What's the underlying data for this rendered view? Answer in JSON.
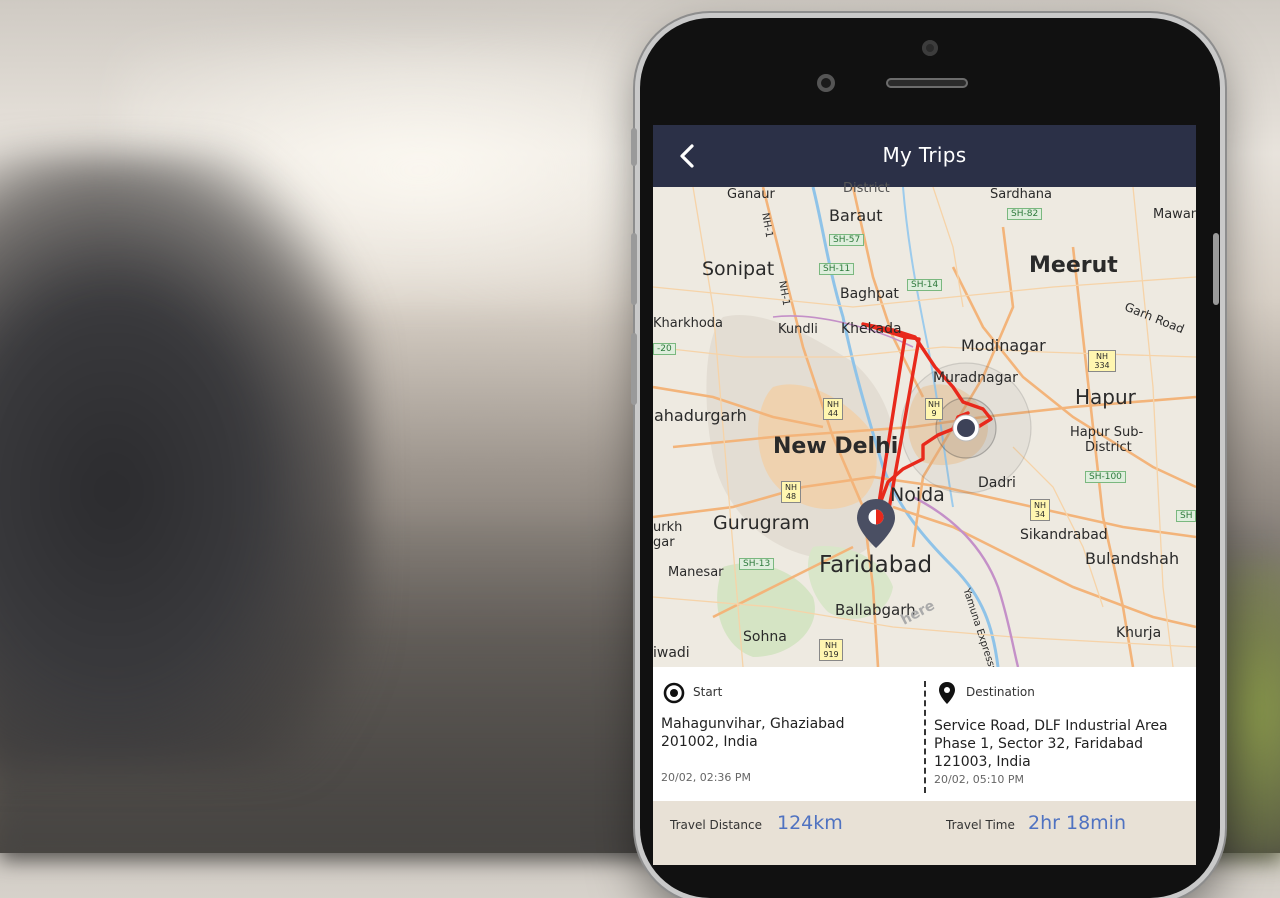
{
  "header": {
    "title": "My Trips",
    "back_icon": "chevron-left-icon"
  },
  "map": {
    "cities": [
      {
        "name": "Ganaur",
        "key": "ganaur"
      },
      {
        "name": "District",
        "key": "district"
      },
      {
        "name": "Sardhana",
        "key": "sardhana"
      },
      {
        "name": "Mawan",
        "key": "mawan"
      },
      {
        "name": "Baraut",
        "key": "baraut"
      },
      {
        "name": "Sonipat",
        "key": "sonipat"
      },
      {
        "name": "Meerut",
        "key": "meerut"
      },
      {
        "name": "Baghpat",
        "key": "baghpat"
      },
      {
        "name": "Garh Road",
        "key": "garh-road"
      },
      {
        "name": "Kharkhoda",
        "key": "kharkhoda"
      },
      {
        "name": "Kundli",
        "key": "kundli"
      },
      {
        "name": "Khekada",
        "key": "khekada"
      },
      {
        "name": "Modinagar",
        "key": "modinagar"
      },
      {
        "name": "Muradnagar",
        "key": "muradnagar"
      },
      {
        "name": "Bahadurgarh",
        "key": "bahadurgarh"
      },
      {
        "name": "Hapur",
        "key": "hapur"
      },
      {
        "name": "Hapur Sub-",
        "key": "hapur-sub"
      },
      {
        "name": "District",
        "key": "hapur-district"
      },
      {
        "name": "New Delhi",
        "key": "new-delhi"
      },
      {
        "name": "Dadri",
        "key": "dadri"
      },
      {
        "name": "Noida",
        "key": "noida"
      },
      {
        "name": "Gurugram",
        "key": "gurugram"
      },
      {
        "name": "urkh",
        "key": "jhajjar-frag"
      },
      {
        "name": "gar",
        "key": "gar-frag"
      },
      {
        "name": "Sikandrabad",
        "key": "sikandrabad"
      },
      {
        "name": "Bulandshah",
        "key": "bulandshah"
      },
      {
        "name": "Manesar",
        "key": "manesar"
      },
      {
        "name": "Faridabad",
        "key": "faridabad"
      },
      {
        "name": "Ballabgarh",
        "key": "ballabgarh"
      },
      {
        "name": "Sohna",
        "key": "sohna"
      },
      {
        "name": "Khurja",
        "key": "khurja"
      },
      {
        "name": "iwadi",
        "key": "rewari-frag"
      },
      {
        "name": "Yamuna Expressway",
        "key": "yamuna"
      },
      {
        "name": "NH-1",
        "key": "nh1-top"
      },
      {
        "name": "NH-1",
        "key": "nh1-mid"
      },
      {
        "name": "here",
        "key": "here"
      }
    ],
    "shields": [
      {
        "text": "SH-82",
        "key": "sh82"
      },
      {
        "text": "SH-57",
        "key": "sh57"
      },
      {
        "text": "SH-11",
        "key": "sh11"
      },
      {
        "text": "SH-14",
        "key": "sh14"
      },
      {
        "text": "NH 334",
        "key": "nh334"
      },
      {
        "text": "-20",
        "key": "sh20"
      },
      {
        "text": "NH 44",
        "key": "nh44"
      },
      {
        "text": "NH 9",
        "key": "nh9"
      },
      {
        "text": "SH-100",
        "key": "sh100"
      },
      {
        "text": "NH 48",
        "key": "nh48"
      },
      {
        "text": "NH 34",
        "key": "nh34"
      },
      {
        "text": "SH-13",
        "key": "sh13"
      },
      {
        "text": "NH 919",
        "key": "nh919"
      },
      {
        "text": "SH",
        "key": "sh-right"
      }
    ],
    "route_color": "#e8291c",
    "marker_start": "target-marker-icon",
    "marker_destination": "map-pin-icon"
  },
  "trip": {
    "start": {
      "label": "Start",
      "icon": "start-circle-icon",
      "address_line1": "Mahagunvihar, Ghaziabad",
      "address_line2": "201002, India",
      "time": "20/02, 02:36 PM"
    },
    "destination": {
      "label": "Destination",
      "icon": "location-pin-icon",
      "address_line1": "Service Road, DLF Industrial Area",
      "address_line2": "Phase 1, Sector 32, Faridabad",
      "address_line3": "121003, India",
      "time": "20/02, 05:10 PM"
    }
  },
  "stats": {
    "distance_label": "Travel Distance",
    "distance_value": "124km",
    "time_label": "Travel Time",
    "time_value": "2hr 18min"
  },
  "colors": {
    "header_bg": "#2b3047",
    "accent": "#4f72c1",
    "stats_bg": "#e8e1d6"
  }
}
